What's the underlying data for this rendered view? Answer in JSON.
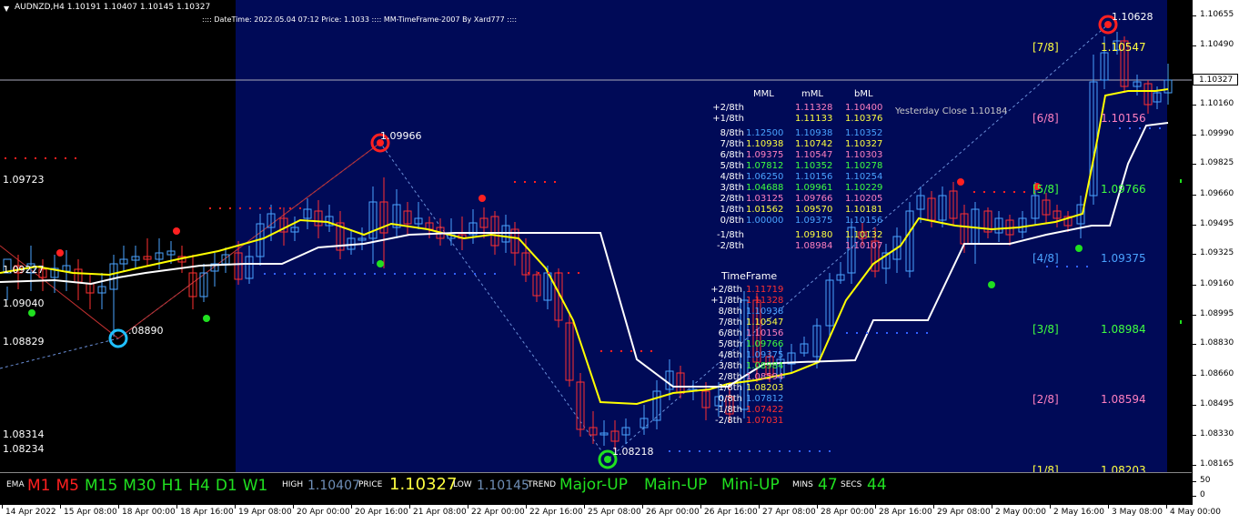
{
  "header": {
    "symbol_line": "AUDNZD,H4  1.10191 1.10407 1.10145 1.10327",
    "info_line": ":::: DateTime: 2022.05.04 07:12   Price: 1.1033 :::: MM-TimeFrame-2007 By Xard777 ::::"
  },
  "price_axis": {
    "ticks": [
      "1.10655",
      "1.10490",
      "1.10327",
      "1.10160",
      "1.09990",
      "1.09825",
      "1.09660",
      "1.09495",
      "1.09325",
      "1.09160",
      "1.08995",
      "1.08830",
      "1.08660",
      "1.08495",
      "1.08330",
      "1.08165"
    ],
    "current_price": "1.10327"
  },
  "indicator_axis": {
    "ticks": [
      "50",
      "0"
    ]
  },
  "time_axis": {
    "labels": [
      "14 Apr 2022",
      "15 Apr 08:00",
      "18 Apr 00:00",
      "18 Apr 16:00",
      "19 Apr 08:00",
      "20 Apr 00:00",
      "20 Apr 16:00",
      "21 Apr 08:00",
      "22 Apr 00:00",
      "22 Apr 16:00",
      "25 Apr 08:00",
      "26 Apr 00:00",
      "26 Apr 16:00",
      "27 Apr 08:00",
      "28 Apr 00:00",
      "28 Apr 16:00",
      "29 Apr 08:00",
      "2 May 00:00",
      "2 May 16:00",
      "3 May 08:00",
      "4 May 00:00"
    ]
  },
  "zigzag_labels": {
    "high1": "1.09966",
    "low1": ".08890",
    "high2": "1.10628",
    "low2": "1.08218"
  },
  "left_levels": {
    "l1": "1.09723",
    "l2": "1.09227",
    "l3": "1.09040",
    "l4": "1.08829",
    "l5": "1.08314",
    "l6": "1.08234"
  },
  "yesterday_close": "Yesterday Close 1.10184",
  "mml_table": {
    "headers": [
      "MML",
      "mML",
      "bML"
    ],
    "rows": [
      {
        "label": "+2/8th",
        "c1": "1.11328",
        "c2": "1.10400",
        "color": "#ff80c0"
      },
      {
        "label": "+1/8th",
        "c1": "1.11133",
        "c2": "1.10376",
        "color": "#ffff40"
      },
      {
        "label": "8/8th",
        "c0": "1.12500",
        "c1": "1.10938",
        "c2": "1.10352",
        "color": "#4aa3ff"
      },
      {
        "label": "7/8th",
        "c0": "1.10938",
        "c1": "1.10742",
        "c2": "1.10327",
        "color": "#ffff40"
      },
      {
        "label": "6/8th",
        "c0": "1.09375",
        "c1": "1.10547",
        "c2": "1.10303",
        "color": "#ff80c0"
      },
      {
        "label": "5/8th",
        "c0": "1.07812",
        "c1": "1.10352",
        "c2": "1.10278",
        "color": "#40ff40"
      },
      {
        "label": "4/8th",
        "c0": "1.06250",
        "c1": "1.10156",
        "c2": "1.10254",
        "color": "#4aa3ff"
      },
      {
        "label": "3/8th",
        "c0": "1.04688",
        "c1": "1.09961",
        "c2": "1.10229",
        "color": "#40ff40"
      },
      {
        "label": "2/8th",
        "c0": "1.03125",
        "c1": "1.09766",
        "c2": "1.10205",
        "color": "#ff80c0"
      },
      {
        "label": "1/8th",
        "c0": "1.01562",
        "c1": "1.09570",
        "c2": "1.10181",
        "color": "#ffff40"
      },
      {
        "label": "0/8th",
        "c0": "1.00000",
        "c1": "1.09375",
        "c2": "1.10156",
        "color": "#4aa3ff"
      },
      {
        "label": "-1/8th",
        "c1": "1.09180",
        "c2": "1.10132",
        "color": "#ffff40"
      },
      {
        "label": "-2/8th",
        "c1": "1.08984",
        "c2": "1.10107",
        "color": "#ff80c0"
      }
    ]
  },
  "timeframe_table": {
    "title": "TimeFrame",
    "rows": [
      {
        "label": "+2/8th",
        "value": "1.11719",
        "color": "#ff3030"
      },
      {
        "label": "+1/8th",
        "value": "1.11328",
        "color": "#ff3030"
      },
      {
        "label": "8/8th",
        "value": "1.10938",
        "color": "#4aa3ff"
      },
      {
        "label": "7/8th",
        "value": "1.10547",
        "color": "#ffff40"
      },
      {
        "label": "6/8th",
        "value": "1.10156",
        "color": "#ff80c0"
      },
      {
        "label": "5/8th",
        "value": "1.09766",
        "color": "#40ff40"
      },
      {
        "label": "4/8th",
        "value": "1.09375",
        "color": "#4aa3ff"
      },
      {
        "label": "3/8th",
        "value": "1.08984",
        "color": "#40ff40"
      },
      {
        "label": "2/8th",
        "value": "1.08594",
        "color": "#ff80c0"
      },
      {
        "label": "1/8th",
        "value": "1.08203",
        "color": "#ffff40"
      },
      {
        "label": "0/8th",
        "value": "1.07812",
        "color": "#4aa3ff"
      },
      {
        "label": "-1/8th",
        "value": "1.07422",
        "color": "#ff3030"
      },
      {
        "label": "-2/8th",
        "value": "1.07031",
        "color": "#ff3030"
      }
    ]
  },
  "right_levels": [
    {
      "label": "[7/8]",
      "value": "1.10547",
      "color": "#ffff40"
    },
    {
      "label": "[6/8]",
      "value": "1.10156",
      "color": "#ff80c0"
    },
    {
      "label": "[5/8]",
      "value": "1.09766",
      "color": "#40ff40"
    },
    {
      "label": "[4/8]",
      "value": "1.09375",
      "color": "#4aa3ff"
    },
    {
      "label": "[3/8]",
      "value": "1.08984",
      "color": "#40ff40"
    },
    {
      "label": "[2/8]",
      "value": "1.08594",
      "color": "#ff80c0"
    },
    {
      "label": "[1/8]",
      "value": "1.08203",
      "color": "#ffff40"
    }
  ],
  "indicator": {
    "ema": "EMA",
    "timeframes": [
      {
        "label": "M1",
        "color": "#ff2020"
      },
      {
        "label": "M5",
        "color": "#ff2020"
      },
      {
        "label": "M15",
        "color": "#20e020"
      },
      {
        "label": "M30",
        "color": "#20e020"
      },
      {
        "label": "H1",
        "color": "#20e020"
      },
      {
        "label": "H4",
        "color": "#20e020"
      },
      {
        "label": "D1",
        "color": "#20e020"
      },
      {
        "label": "W1",
        "color": "#20e020"
      }
    ],
    "high_label": "HIGH",
    "high_value": "1.10407",
    "price_label": "PRICE",
    "price_value": "1.10327",
    "low_label": "LOW",
    "low_value": "1.10145",
    "trend_label": "TREND",
    "major": "Major-UP",
    "main": "Main-UP",
    "mini": "Mini-UP",
    "mins_label": "MINS",
    "mins_value": "47",
    "secs_label": "SECS",
    "secs_value": "44"
  },
  "colors": {
    "chart_bg": "#000a57",
    "bull": "#4aa3ff",
    "bear": "#ff3030",
    "ma_yellow": "#ffff00",
    "ma_white": "#ffffff"
  }
}
